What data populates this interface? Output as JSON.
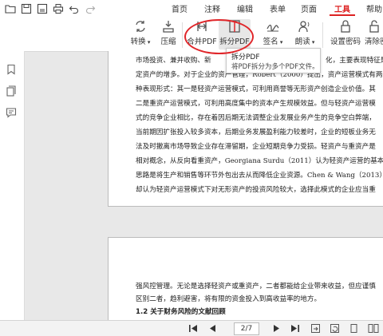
{
  "menu": {
    "items": [
      "首页",
      "注释",
      "编辑",
      "表单",
      "页面",
      "工具",
      "帮助"
    ],
    "active": "工具"
  },
  "ribbon": {
    "convert": "转换",
    "compress": "压缩",
    "merge": "合并PDF",
    "split": "拆分PDF",
    "sign": "签名",
    "read": "朗读",
    "set_password": "设置密码",
    "remove_password": "清除密"
  },
  "tooltip": {
    "title": "拆分PDF",
    "description": "将PDF拆分为多个PDF文件。"
  },
  "document": {
    "page1_lines": [
      "市场投资、兼并收购、新",
      "定资产的增多。对于企业的资产管理，Robert（2000）提出，资产运营模式有两",
      "种表现形式：其一是轻资产运营模式，可利用商誉等无形资产创造企业价值。其",
      "二是重资产运营模式，可利用高度集中的资本产生规模效益。但与轻资产运营模",
      "式的竞争企业相比，存在着因后期无法调整企业发展业务产生的竞争空白弊端，",
      "当前期因扩张投入较多资本，后期业务发展盈利能力较差时，企业的短板业务无",
      "法及时撤离市场导致企业存在滞留期，企业短期竞争力受损。轻资产与重资产是",
      "相对概念，从反向看重资产，Georgiana Surdu（2011）认为轻资产运营的基本",
      "思路是将生产和销售等环节外包出去从而降低企业资源。Chen & Wang（2013）",
      "却认为轻资产运营模式下对无形资产的投资风险较大，选择此模式的企业应当重"
    ],
    "page1_fragment": "化，主要表现特征是",
    "page2_lines": [
      "强风控管理。无论是选择轻资产或重资产，二者都能给企业带来收益，但应谨慎",
      "区别二者，趋利避害，将有限的资金投入到高收益率的地方。"
    ],
    "page2_heading": "1.2 关于财务风险的文献回顾"
  },
  "status": {
    "page_indicator": "2/7"
  },
  "colors": {
    "accent_red": "#e0262a",
    "active_tab": "#dd2222"
  },
  "icons": [
    "undo-icon",
    "redo-icon",
    "convert-icon",
    "compress-icon",
    "merge-icon",
    "split-icon",
    "sign-icon",
    "read-icon",
    "lock-icon",
    "bookmark-icon",
    "pages-icon",
    "comment-icon"
  ]
}
